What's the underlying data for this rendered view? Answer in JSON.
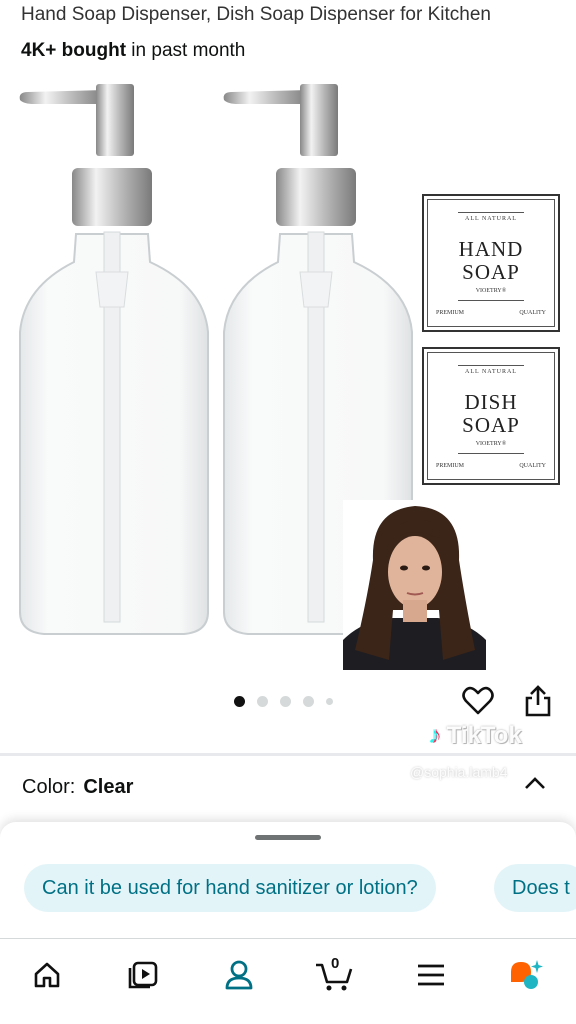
{
  "product": {
    "title_line": "Hand Soap Dispenser, Dish Soap Dispenser for Kitchen",
    "bought_bold": "4K+ bought",
    "bought_rest": " in past month"
  },
  "labels": [
    {
      "top": "ALL NATURAL",
      "line1": "HAND",
      "line2": "SOAP",
      "brand": "VIOETRY®",
      "foot_left": "PREMIUM",
      "foot_right": "QUALITY"
    },
    {
      "top": "ALL NATURAL",
      "line1": "DISH",
      "line2": "SOAP",
      "brand": "VIOETRY®",
      "foot_left": "PREMIUM",
      "foot_right": "QUALITY"
    }
  ],
  "carousel": {
    "active_index": 0,
    "count": 5
  },
  "overlay": {
    "brand": "TikTok",
    "user": "@sophia.lamb4"
  },
  "color": {
    "label": "Color:",
    "value": "Clear"
  },
  "questions": [
    "Can it be used for hand sanitizer or lotion?",
    "Does t"
  ],
  "nav": {
    "cart_count": "0",
    "items": [
      "home-icon",
      "video-icon",
      "account-icon",
      "cart-icon",
      "menu-icon",
      "rufus-icon"
    ]
  },
  "colors": {
    "accent": "#007185",
    "chip_bg": "#e3f4f8",
    "active_nav": "#007185"
  }
}
